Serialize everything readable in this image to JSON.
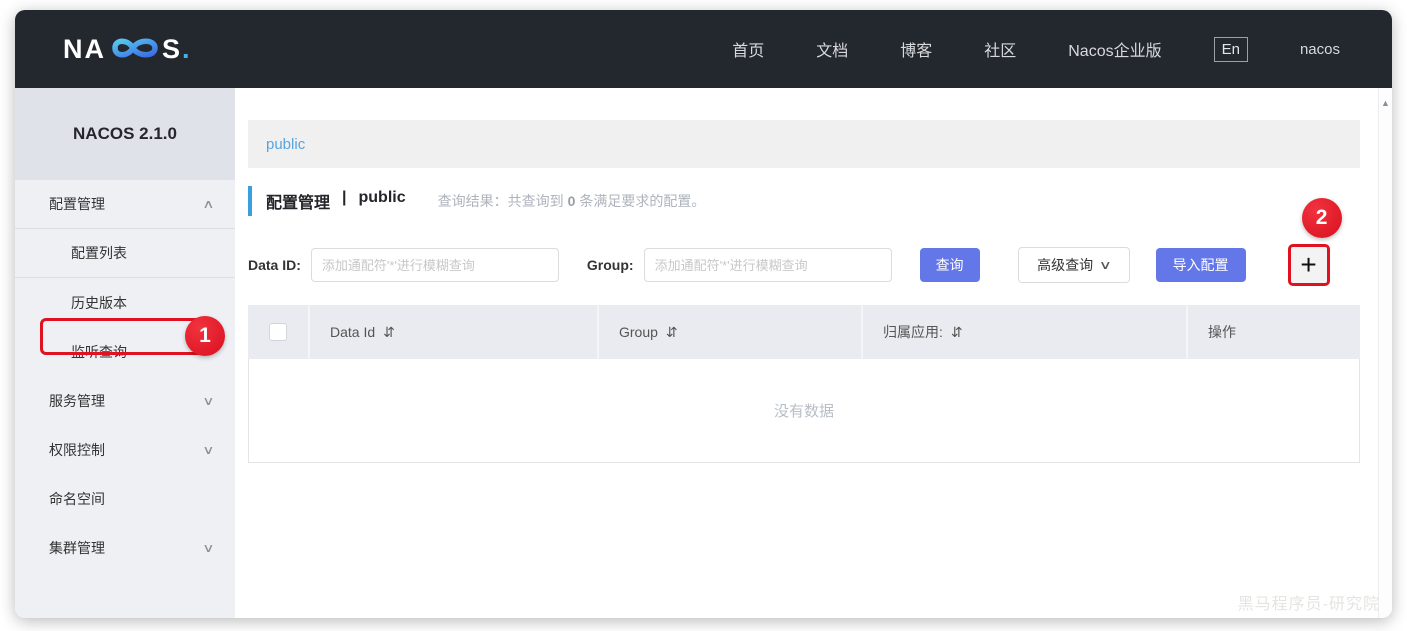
{
  "navbar": {
    "logo_left": "NA",
    "logo_right": "S",
    "logo_dot": ".",
    "items": [
      {
        "label": "首页"
      },
      {
        "label": "文档"
      },
      {
        "label": "博客"
      },
      {
        "label": "社区"
      },
      {
        "label": "Nacos企业版"
      }
    ],
    "lang": "En",
    "user": "nacos"
  },
  "sidebar": {
    "title": "NACOS 2.1.0",
    "items": [
      {
        "label": "配置管理"
      },
      {
        "label": "配置列表"
      },
      {
        "label": "历史版本"
      },
      {
        "label": "监听查询"
      },
      {
        "label": "服务管理"
      },
      {
        "label": "权限控制"
      },
      {
        "label": "命名空间"
      },
      {
        "label": "集群管理"
      }
    ]
  },
  "main": {
    "namespace_tab": "public",
    "heading": {
      "title": "配置管理",
      "separator": "|",
      "namespace": "public",
      "result_prefix": "查询结果：共查询到",
      "result_count": "0",
      "result_suffix": "条满足要求的配置。"
    },
    "search": {
      "data_id_label": "Data ID:",
      "data_id_value": "",
      "data_id_placeholder": "添加通配符'*'进行模糊查询",
      "group_label": "Group:",
      "group_value": "",
      "group_placeholder": "添加通配符'*'进行模糊查询",
      "query_button": "查询",
      "advanced_button": "高级查询",
      "import_button": "导入配置",
      "add_button": "+"
    },
    "table": {
      "columns": {
        "data_id": "Data Id",
        "group": "Group",
        "app": "归属应用:",
        "ops": "操作"
      },
      "empty_text": "没有数据"
    }
  },
  "annotations": {
    "step1": "1",
    "step2": "2"
  },
  "icons": {
    "chevron_up": "∧",
    "chevron_down": "∨",
    "sort": "⇵",
    "scroll_up": "▲"
  },
  "colors": {
    "navbar_bg": "#23272e",
    "primary_button": "#6377e8",
    "annotation_red": "#e01120",
    "namespace_link": "#58a4dd",
    "heading_bar": "#3aa0dc"
  },
  "watermark": "黑马程序员-研究院"
}
